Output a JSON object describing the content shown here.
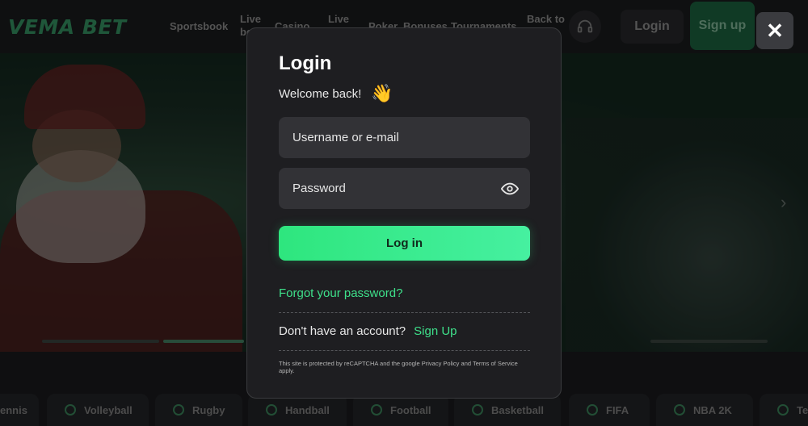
{
  "header": {
    "logo": "VEMA BET",
    "nav": [
      {
        "label": "Sportsbook"
      },
      {
        "label": "Live be"
      },
      {
        "label": "Casino"
      },
      {
        "label": "Live"
      },
      {
        "label": "Poker"
      },
      {
        "label": "Bonuses"
      },
      {
        "label": "Tournaments"
      },
      {
        "label": "Back to"
      }
    ],
    "login_label": "Login",
    "signup_label": "Sign up",
    "close_label": "✕"
  },
  "modal": {
    "title": "Login",
    "welcome": "Welcome back!",
    "wave_emoji": "👋",
    "username_placeholder": "Username or e-mail",
    "password_placeholder": "Password",
    "login_button": "Log in",
    "forgot_password": "Forgot your password?",
    "no_account_text": "Don't have an account?",
    "signup_link": "Sign Up",
    "recaptcha_text": "This site is protected by reCAPTCHA and the google Privacy Policy and Terms of Service apply."
  },
  "sports": [
    {
      "label": "ennis"
    },
    {
      "label": "Volleyball"
    },
    {
      "label": "Rugby"
    },
    {
      "label": "Handball"
    },
    {
      "label": "Football"
    },
    {
      "label": "Basketball"
    },
    {
      "label": "FIFA"
    },
    {
      "label": "NBA 2K"
    },
    {
      "label": "Te"
    }
  ],
  "colors": {
    "accent": "#2ee67e",
    "link": "#3ee08a",
    "modal_bg": "#1e1e21",
    "field_bg": "#323236"
  }
}
